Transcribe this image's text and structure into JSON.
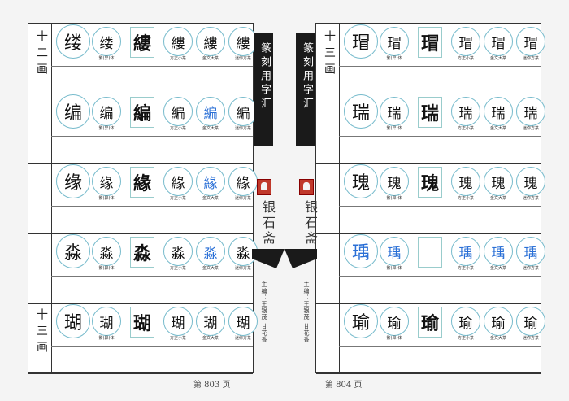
{
  "left": {
    "page_number": "第 803 页",
    "sections": [
      {
        "label": "十二画",
        "rows": [
          0,
          1,
          2,
          3
        ]
      },
      {
        "label": "十三画",
        "rows": [
          4
        ]
      }
    ],
    "rows": [
      {
        "char": "缕",
        "cells": [
          "缕",
          "縷",
          "縷",
          "縷",
          "縷"
        ],
        "blue": []
      },
      {
        "char": "编",
        "cells": [
          "编",
          "編",
          "編",
          "編",
          "編"
        ],
        "blue": [
          4
        ]
      },
      {
        "char": "缘",
        "cells": [
          "缘",
          "緣",
          "緣",
          "緣",
          "緣"
        ],
        "blue": [
          4
        ]
      },
      {
        "char": "淼",
        "cells": [
          "淼",
          "淼",
          "淼",
          "淼",
          "淼"
        ],
        "blue": [
          4
        ]
      },
      {
        "char": "瑚",
        "cells": [
          "瑚",
          "瑚",
          "瑚",
          "瑚",
          "瑚"
        ],
        "blue": []
      }
    ],
    "captions": [
      "繁(异)体",
      "方正小篆",
      "金文大篆",
      "迷你方篆"
    ]
  },
  "right": {
    "page_number": "第 804 页",
    "sections": [
      {
        "label": "十三画"
      }
    ],
    "rows": [
      {
        "char": "瑁",
        "cells": [
          "瑁",
          "瑁",
          "瑁",
          "瑁",
          "瑁"
        ],
        "blue": []
      },
      {
        "char": "瑞",
        "cells": [
          "瑞",
          "瑞",
          "瑞",
          "瑞",
          "瑞"
        ],
        "blue": []
      },
      {
        "char": "瑰",
        "cells": [
          "瑰",
          "瑰",
          "瑰",
          "瑰",
          "瑰"
        ],
        "blue": []
      },
      {
        "char": "瑀",
        "cells": [
          "瑀",
          "",
          "瑀",
          "瑀",
          "瑀"
        ],
        "blue": [
          0,
          1,
          3,
          4,
          5
        ]
      },
      {
        "char": "瑜",
        "cells": [
          "瑜",
          "瑜",
          "瑜",
          "瑜",
          "瑜"
        ],
        "blue": []
      }
    ],
    "captions": [
      "繁(异)体",
      "方正小篆",
      "金文大篆",
      "迷你方篆"
    ]
  },
  "spine": {
    "title": "篆刻用字汇",
    "brand": "银石斋",
    "credit": "主编：王银茂 甘花香"
  },
  "colors": {
    "seal": "#c0392b",
    "accent_blue": "#2a6fd6"
  }
}
